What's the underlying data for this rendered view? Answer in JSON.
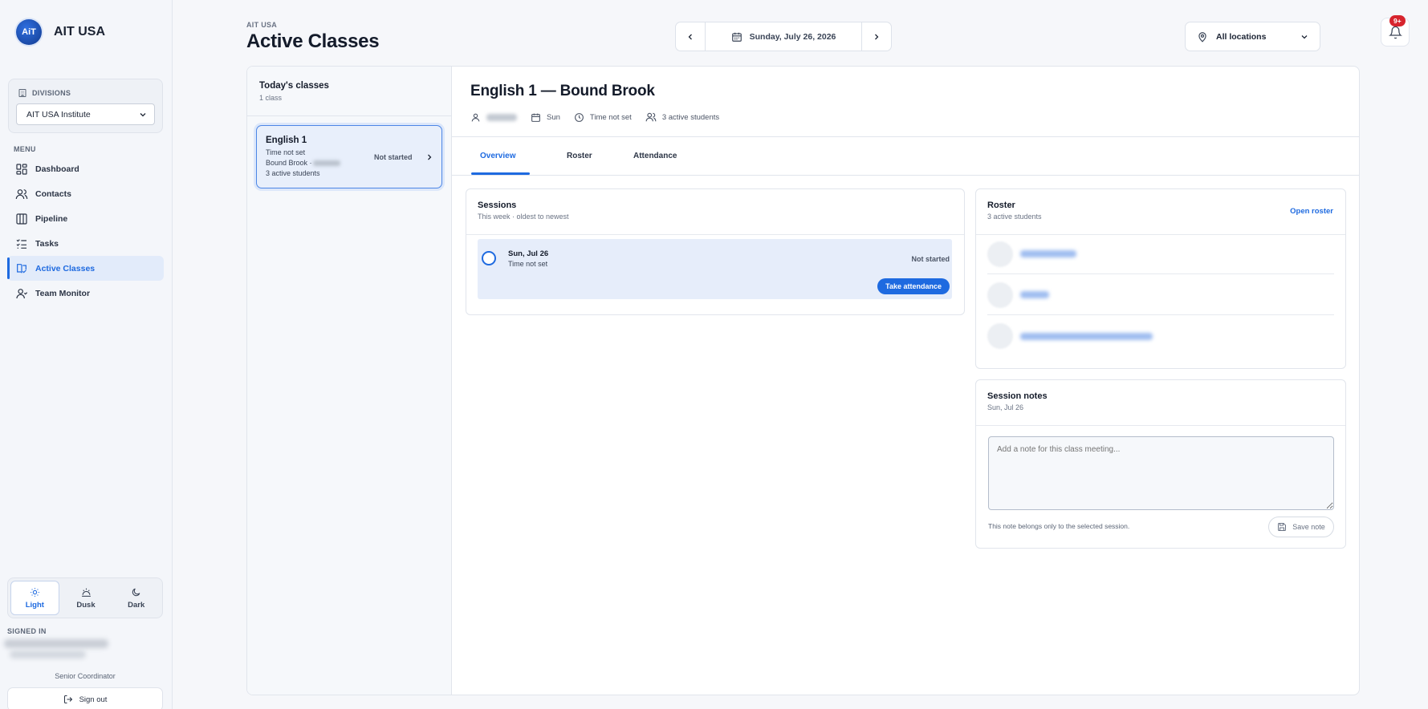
{
  "brand": {
    "logo_text": "AiT",
    "name": "AIT USA"
  },
  "divisions": {
    "label": "DIVISIONS",
    "selected": "AIT USA Institute"
  },
  "menu": {
    "label": "MENU",
    "items": [
      {
        "label": "Dashboard",
        "icon": "dashboard-icon",
        "active": false
      },
      {
        "label": "Contacts",
        "icon": "contacts-icon",
        "active": false
      },
      {
        "label": "Pipeline",
        "icon": "pipeline-icon",
        "active": false
      },
      {
        "label": "Tasks",
        "icon": "tasks-icon",
        "active": false
      },
      {
        "label": "Active Classes",
        "icon": "active-classes-icon",
        "active": true
      },
      {
        "label": "Team Monitor",
        "icon": "team-monitor-icon",
        "active": false
      }
    ]
  },
  "theme": {
    "options": [
      "Light",
      "Dusk",
      "Dark"
    ],
    "selected": "Light"
  },
  "account": {
    "signed_in_label": "SIGNED IN",
    "role": "Senior Coordinator",
    "sign_out_label": "Sign out"
  },
  "header": {
    "eyebrow": "AIT USA",
    "title": "Active Classes",
    "date": "Sunday, July 26, 2026",
    "location": "All locations",
    "notification_badge": "9+"
  },
  "classes_list": {
    "title": "Today's classes",
    "count": "1 class",
    "items": [
      {
        "name": "English 1",
        "time": "Time not set",
        "location": "Bound Brook ·",
        "students": "3 active students",
        "status": "Not started"
      }
    ]
  },
  "class_detail": {
    "title": "English 1 — Bound Brook",
    "day": "Sun",
    "time": "Time not set",
    "students": "3 active students",
    "tabs": [
      "Overview",
      "Roster",
      "Attendance"
    ],
    "active_tab": "Overview"
  },
  "sessions": {
    "title": "Sessions",
    "subtitle": "This week · oldest to newest",
    "items": [
      {
        "date": "Sun, Jul 26",
        "time": "Time not set",
        "status": "Not started",
        "action": "Take attendance"
      }
    ]
  },
  "roster": {
    "title": "Roster",
    "subtitle": "3 active students",
    "link": "Open roster"
  },
  "notes": {
    "title": "Session notes",
    "subtitle": "Sun, Jul 26",
    "placeholder": "Add a note for this class meeting...",
    "hint": "This note belongs only to the selected session.",
    "save_label": "Save note"
  },
  "colors": {
    "accent": "#1e6ae0",
    "badge": "#d7242d",
    "selected_bg": "#e6edfa"
  }
}
